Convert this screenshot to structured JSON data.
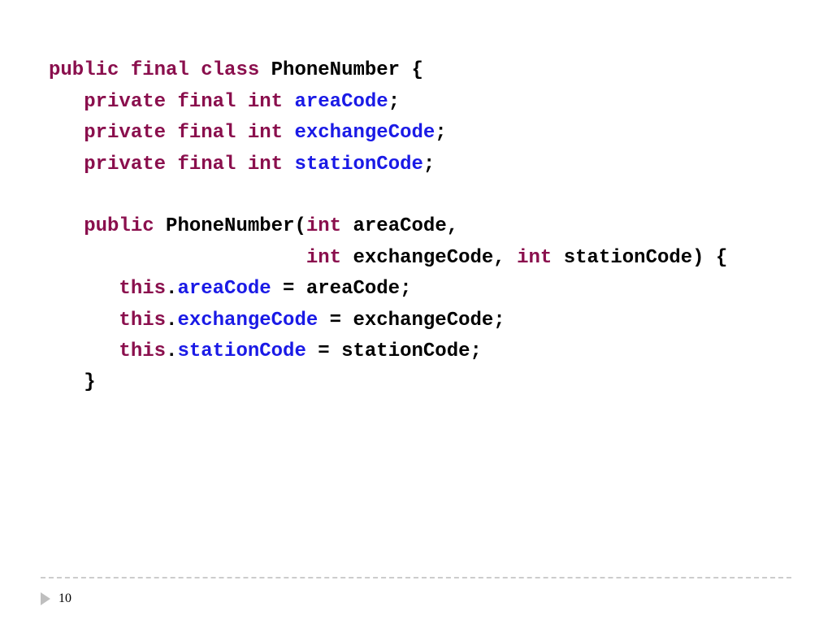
{
  "slide": {
    "page_number": "10"
  },
  "code": {
    "l1": {
      "kw1": "public final class",
      "name": " PhoneNumber {",
      "text_class": "PhoneNumber"
    },
    "l2": {
      "kw": "private final int",
      "field": "areaCode"
    },
    "l3": {
      "kw": "private final int",
      "field": "exchangeCode"
    },
    "l4": {
      "kw": "private final int",
      "field": "stationCode"
    },
    "l6": {
      "kw": "public",
      "ctor": " PhoneNumber(",
      "type": "int",
      "param": " areaCode,"
    },
    "l7": {
      "type1": "int",
      "p1": " exchangeCode, ",
      "type2": "int",
      "p2": " stationCode) {"
    },
    "l8": {
      "this": "this",
      "dot": ".",
      "field": "areaCode",
      "rest": " = areaCode;"
    },
    "l9": {
      "this": "this",
      "dot": ".",
      "field": "exchangeCode",
      "rest": " = exchangeCode;"
    },
    "l10": {
      "this": "this",
      "dot": ".",
      "field": "stationCode",
      "rest": " = stationCode;"
    },
    "l11": "   }",
    "indent1": "   ",
    "indent2": "      ",
    "indent_ctor_param": "                      ",
    "semicolon": ";",
    "space": " "
  }
}
